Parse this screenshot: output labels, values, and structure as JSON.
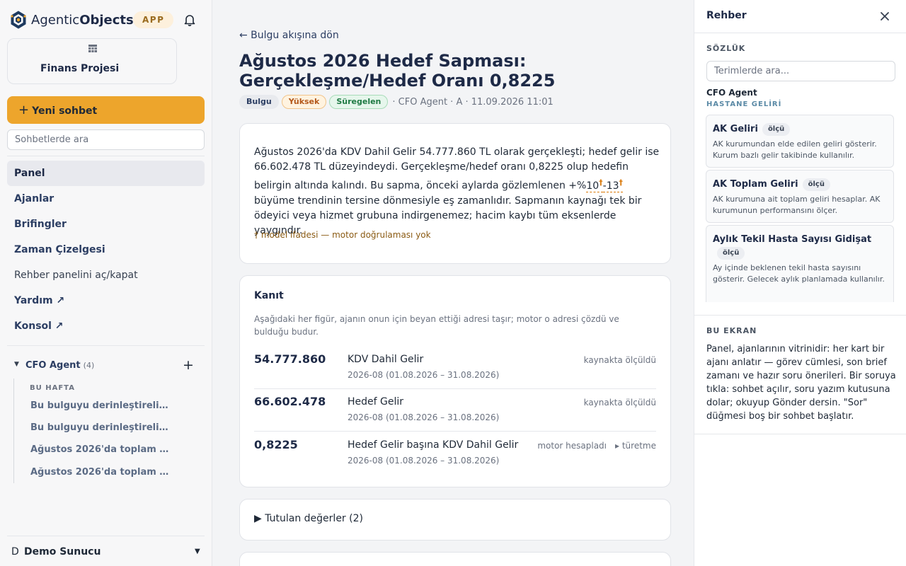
{
  "brand": {
    "name_light": "Agentic",
    "name_bold": "Objects",
    "badge": "APP"
  },
  "project": {
    "name": "Finans Projesi"
  },
  "sidebar": {
    "new_chat": "Yeni sohbet",
    "search_placeholder": "Sohbetlerde ara",
    "nav": [
      {
        "label": "Panel"
      },
      {
        "label": "Ajanlar"
      },
      {
        "label": "Brifingler"
      },
      {
        "label": "Zaman Çizelgesi"
      },
      {
        "label": "Rehber panelini aç/kapat"
      },
      {
        "label": "Yardım ↗"
      },
      {
        "label": "Konsol ↗"
      }
    ],
    "agent": {
      "name": "CFO Agent",
      "count": "(4)"
    },
    "week_label": "BU HAFTA",
    "threads": [
      "Bu bulguyu derinleştirelim …",
      "Bu bulguyu derinleştirelim …",
      "Ağustos 2026'da toplam gelir…",
      "Ağustos 2026'da toplam gelir…"
    ],
    "user": {
      "initial": "D",
      "name": "Demo Sunucu"
    }
  },
  "main": {
    "back_link": "← Bulgu akışına dön",
    "title": "Ağustos 2026 Hedef Sapması: Gerçekleşme/Hedef Oranı 0,8225",
    "tags": {
      "type": "Bulgu",
      "severity": "Yüksek",
      "status": "Süregelen"
    },
    "meta": "· CFO Agent · A · 11.09.2026 11:01",
    "summary": {
      "part1": "Ağustos 2026'da KDV Dahil Gelir 54.777.860 TL olarak gerçekleşti; hedef gelir ise 66.602.478 TL düzeyindeydi. Gerçekleşme/hedef oranı 0,8225 olup hedefin belirgin altında kalındı. Bu sapma, önceki aylarda gözlemlenen +%",
      "flag1": "10",
      "dagger": "†",
      "flag2": "-13",
      "part2": " büyüme trendinin tersine dönmesiyle eş zamanlıdır. Sapmanın kaynağı tek bir ödeyici veya hizmet grubuna indirgenemez; hacim kaybı tüm eksenlerde yaygındır.",
      "model_note": "† model ifadesi — motor doğrulaması yok"
    },
    "evidence": {
      "title": "Kanıt",
      "description": "Aşağıdaki her figür, ajanın onun için beyan ettiği adresi taşır; motor o adresi çözdü ve bulduğu budur.",
      "rows": [
        {
          "value": "54.777.860",
          "name": "KDV Dahil Gelir",
          "period": "2026-08 (01.08.2026 – 31.08.2026)",
          "source": "kaynakta ölçüldü",
          "derive": ""
        },
        {
          "value": "66.602.478",
          "name": "Hedef Gelir",
          "period": "2026-08 (01.08.2026 – 31.08.2026)",
          "source": "kaynakta ölçüldü",
          "derive": ""
        },
        {
          "value": "0,8225",
          "name": "Hedef Gelir başına KDV Dahil Gelir",
          "period": "2026-08 (01.08.2026 – 31.08.2026)",
          "source": "motor hesapladı",
          "derive": "▸ türetme"
        }
      ]
    },
    "held_values": "Tutulan değerler (2)"
  },
  "guide": {
    "title": "Rehber",
    "glossary_label": "SÖZLÜK",
    "search_placeholder": "Terimlerde ara...",
    "agent": "CFO Agent",
    "group": "HASTANE GELİRİ",
    "terms": [
      {
        "name": "AK Geliri",
        "badge": "ölçü",
        "desc": "AK kurumundan elde edilen geliri gösterir. Kurum bazlı gelir takibinde kullanılır."
      },
      {
        "name": "AK Toplam Geliri",
        "badge": "ölçü",
        "desc": "AK kurumuna ait toplam geliri hesaplar. AK kurumunun performansını ölçer."
      },
      {
        "name": "Aylık Tekil Hasta Sayısı Gidişat",
        "badge": "ölçü",
        "desc": "Ay içinde beklenen tekil hasta sayısını gösterir. Gelecek aylık planlamada kullanılır."
      }
    ],
    "screen_label": "BU EKRAN",
    "screen_text": "Panel, ajanlarının vitrinidir: her kart bir ajanı anlatır — görev cümlesi, son brief zamanı ve hazır soru önerileri. Bir soruya tıkla: sohbet açılır, soru yazım kutusuna dolar; okuyup Gönder dersin. \"Sor\" düğmesi boş bir sohbet başlatır."
  },
  "colors": {
    "accent": "#eda52c",
    "navy": "#1e2a47",
    "dagger": "#d97706"
  }
}
